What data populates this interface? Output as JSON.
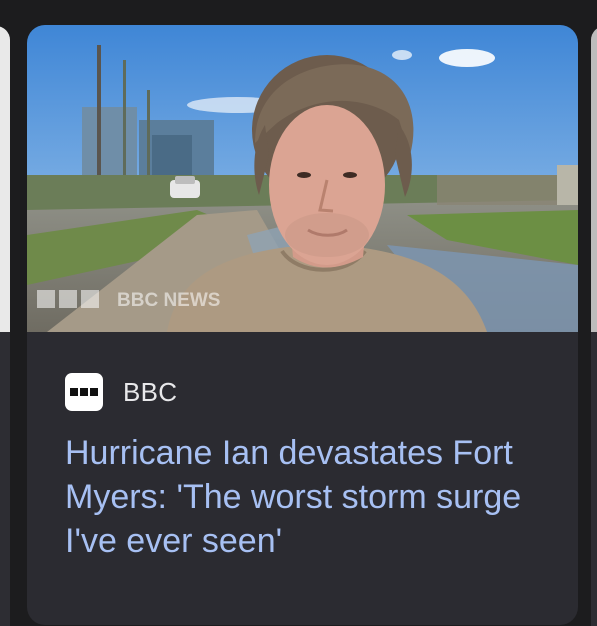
{
  "card": {
    "source": {
      "name": "BBC",
      "icon": "bbc-logo-icon"
    },
    "headline": "Hurricane Ian devastates Fort Myers: 'The worst storm surge I've ever seen'",
    "image": {
      "watermark": "BBC NEWS"
    }
  },
  "colors": {
    "background": "#1c1c1e",
    "card_background": "#2b2b31",
    "headline": "#a7c0f3",
    "source_text": "#e8e8ea"
  }
}
